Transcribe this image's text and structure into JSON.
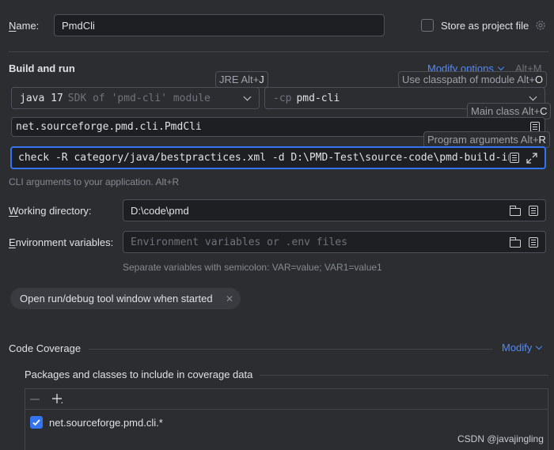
{
  "name": {
    "label": "Name:",
    "mnemonic": "N",
    "label_rest": "ame:",
    "value": "PmdCli"
  },
  "store": {
    "label": "Store as project file",
    "checked": false
  },
  "build": {
    "title": "Build and run",
    "modify_options": "Modify options",
    "modify_shortcut": "Alt+M",
    "jre_hint_text": "JRE Alt+",
    "jre_hint_key": "J",
    "classpath_hint_text": "Use classpath of module Alt+",
    "classpath_hint_key": "O",
    "main_class_hint_text": "Main class Alt+",
    "main_class_hint_key": "C",
    "program_args_hint_text": "Program arguments Alt+",
    "program_args_hint_key": "R",
    "jdk_name": "java 17",
    "jdk_detail": "SDK of 'pmd-cli' module",
    "cp_flag": "-cp",
    "cp_module": "pmd-cli",
    "main_class": "net.sourceforge.pmd.cli.PmdCli",
    "program_args": "check -R category/java/bestpractices.xml -d D:\\PMD-Test\\source-code\\pmd-build-in-rule\\sr",
    "cli_hint": "CLI arguments to your application. Alt+R"
  },
  "working_dir": {
    "mnemonic": "W",
    "label_rest": "orking directory:",
    "value": "D:\\code\\pmd"
  },
  "env": {
    "mnemonic": "E",
    "label_rest": "nvironment variables:",
    "placeholder": "Environment variables or .env files",
    "hint": "Separate variables with semicolon: VAR=value; VAR1=value1"
  },
  "open_tool_window": {
    "label": "Open run/debug tool window when started"
  },
  "coverage": {
    "title": "Code Coverage",
    "modify": "Modify",
    "packages_title": "Packages and classes to include in coverage data",
    "items": [
      {
        "label": "net.sourceforge.pmd.cli.*",
        "checked": true
      }
    ]
  },
  "watermark": "CSDN @javajingling",
  "colors": {
    "accent": "#3574f0",
    "link": "#548af7",
    "background": "#2b2d30",
    "field_bg": "#1e1f22"
  }
}
